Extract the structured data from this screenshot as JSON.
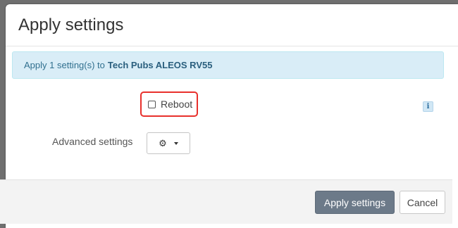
{
  "dialog": {
    "title": "Apply settings"
  },
  "alert": {
    "prefix": "Apply 1 setting(s) to",
    "target": "Tech Pubs ALEOS RV55"
  },
  "reboot": {
    "label": "Reboot",
    "checked": false
  },
  "info": {
    "glyph": "i"
  },
  "advanced": {
    "label": "Advanced settings",
    "icon": "gear-icon"
  },
  "footer": {
    "apply_label": "Apply settings",
    "cancel_label": "Cancel"
  },
  "colors": {
    "apply_button": "#6c7a89",
    "alert_bg": "#d9edf7",
    "highlight": "#e8302c"
  }
}
